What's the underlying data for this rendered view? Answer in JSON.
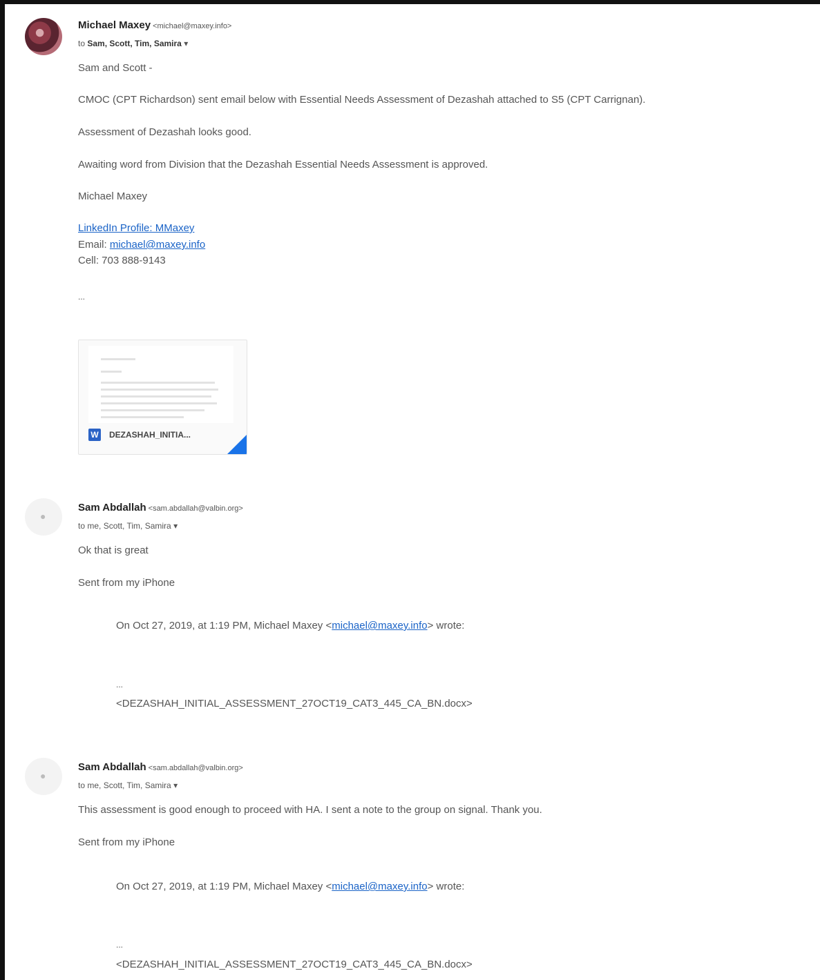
{
  "messages": [
    {
      "sender": "Michael Maxey",
      "email": "<michael@maxey.info>",
      "to_prefix": "to",
      "recipients": "Sam, Scott, Tim, Samira",
      "body": [
        "Sam and Scott -",
        "CMOC (CPT Richardson) sent email below with Essential Needs Assessment of Dezashah attached to S5 (CPT Carrignan).",
        "Assessment of Dezashah looks good.",
        "Awaiting word from Division that the Dezashah Essential Needs Assessment is approved."
      ],
      "signature": {
        "name": "Michael Maxey",
        "linkedin": "LinkedIn Profile: MMaxey",
        "email_label": "Email:",
        "email": "michael@maxey.info",
        "cell": "Cell: 703 888-9143"
      },
      "ellipsis": "...",
      "attachment": {
        "name": "DEZASHAH_INITIA...",
        "icon": "word-doc-icon"
      }
    },
    {
      "sender": "Sam Abdallah",
      "email": "<sam.abdallah@valbin.org>",
      "to_prefix": "to",
      "recipients": "me, Scott, Tim, Samira",
      "body": [
        "Ok that is great",
        "Sent from my iPhone"
      ],
      "quote": {
        "prefix": "On Oct 27, 2019, at 1:19 PM, Michael Maxey <",
        "email": "michael@maxey.info",
        "suffix": "> wrote:",
        "ellipsis": "...",
        "attachment": "<DEZASHAH_INITIAL_ASSESSMENT_27OCT19_CAT3_445_CA_BN.docx>"
      }
    },
    {
      "sender": "Sam Abdallah",
      "email": "<sam.abdallah@valbin.org>",
      "to_prefix": "to",
      "recipients": "me, Scott, Tim, Samira",
      "body": [
        "This assessment is good enough to proceed with HA. I sent a note to the group on signal. Thank you.",
        "Sent from my iPhone"
      ],
      "quote": {
        "prefix": "On Oct 27, 2019, at 1:19 PM, Michael Maxey <",
        "email": "michael@maxey.info",
        "suffix": "> wrote:",
        "ellipsis": "...",
        "attachment": "<DEZASHAH_INITIAL_ASSESSMENT_27OCT19_CAT3_445_CA_BN.docx>"
      }
    }
  ],
  "icons": {
    "dropdown": "chevron-down-icon",
    "avatar_blank": "person-icon"
  }
}
